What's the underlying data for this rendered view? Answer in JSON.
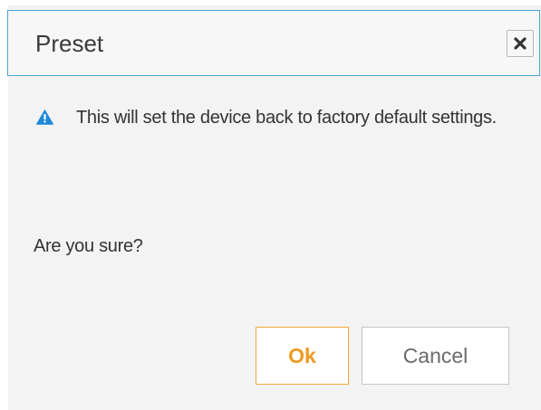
{
  "dialog": {
    "title": "Preset",
    "close_icon": "close-icon",
    "warning_icon": "warning-icon",
    "warning_message": "This will set the device back to factory default settings.",
    "question": "Are you sure?",
    "ok_label": "Ok",
    "cancel_label": "Cancel"
  },
  "colors": {
    "title_border": "#4aa3d6",
    "warning_icon": "#1e88d6",
    "ok_accent": "#ee9a20",
    "dialog_bg": "#f3f3f3"
  }
}
